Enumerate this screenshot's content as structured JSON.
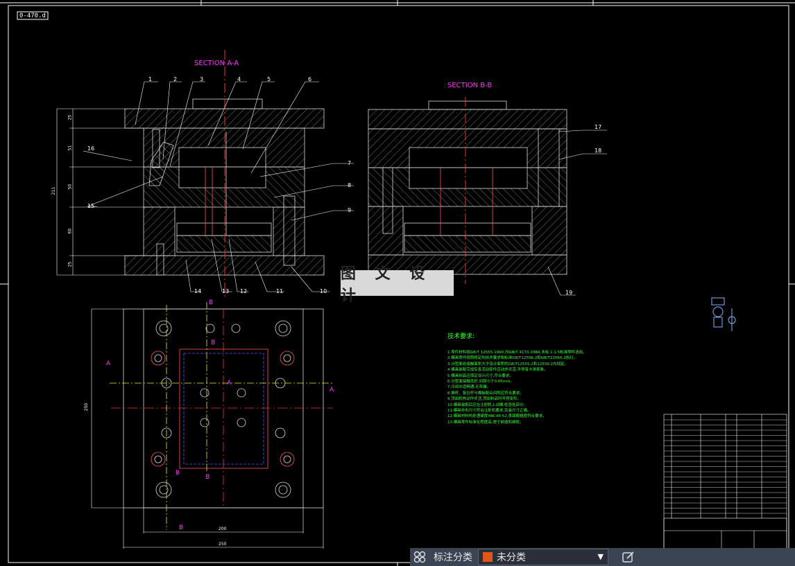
{
  "drawing": {
    "code_label": "0-470.d",
    "section_aa": "SECTION A-A",
    "section_bb": "SECTION B-B",
    "callouts_top": [
      "1",
      "2",
      "3",
      "4",
      "5",
      "6"
    ],
    "callouts_right": [
      "7",
      "8",
      "9"
    ],
    "callouts_bottom": [
      "14",
      "13",
      "12",
      "11",
      "10"
    ],
    "callouts_left": [
      "16",
      "15"
    ],
    "callouts_bb": [
      "17",
      "18",
      "19"
    ],
    "dims_vertical": [
      "25",
      "51",
      "50",
      "60",
      "25",
      "211"
    ],
    "plan_dims": {
      "width_inner": "200",
      "width_outer": "250",
      "height": "250"
    },
    "plan_markers": [
      "A",
      "A",
      "B",
      "B",
      "B",
      "B",
      "A",
      "B"
    ],
    "watermark": "图 文 设 计"
  },
  "tech_notes": {
    "title": "技术要求:",
    "items": [
      "1.零件材料按GB/T 12555-1990,内GB/T 4170-1984,本标 1-1.5标准零件选用。",
      "2.模具零件按照规定的技术要求和标准GB/T12556.2和GB/T12556.2执行。",
      "3.分型面处接触面积大于设计面积的GB/T12555.2和12556.2内规定。",
      "4.模具装配完成后各活动部件应动作灵活,不得有卡滞现象。",
      "5.模具制品应保证设计尺寸,符合要求。",
      "6.分型面接触良好,间隙小于0.05mm。",
      "7.冷却水道畅通,无泄漏。",
      "8.推杆、复位杆与模板配合间隙应符合要求。",
      "9.顶出机构动作灵活,顶出制品时不得变形。",
      "10.模具装配后应在注射机上试模,检查各部分。",
      "11.模具外形尺寸符合注射机要求,安装尺寸正确。",
      "12.模具材料热处理硬度HRC48-52,表面粗糙度符合要求。",
      "13.模具零件标准化程度高,便于制造和维修。"
    ]
  },
  "bottom_bar": {
    "label": "标注分类",
    "selected": "未分类",
    "swatch_color": "#e0561a"
  }
}
